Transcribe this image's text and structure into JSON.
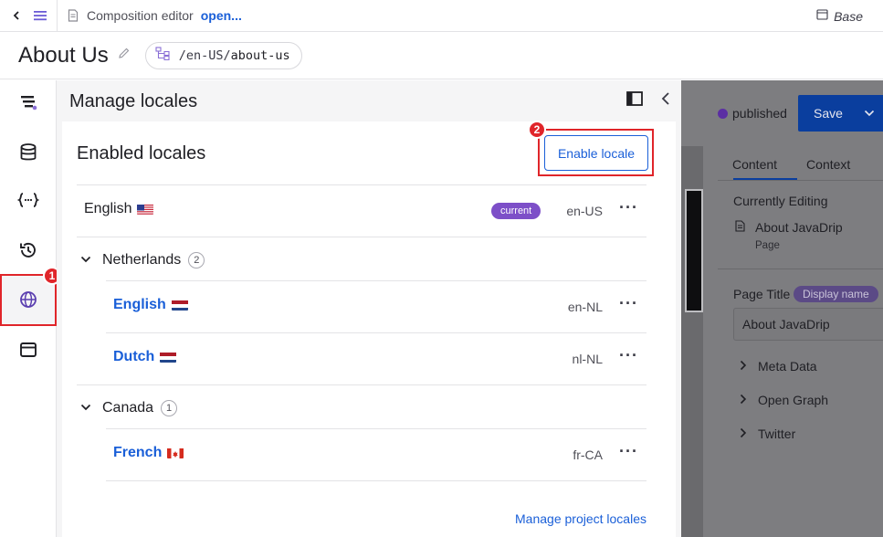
{
  "toolbar": {
    "title": "Composition editor",
    "link": "open...",
    "base_label": "Base"
  },
  "page": {
    "title": "About Us",
    "path_prefix": "/en-US/",
    "path_slug": "about-us"
  },
  "rail": {
    "badge": "1",
    "items": [
      "structure",
      "data",
      "variables",
      "history",
      "locales",
      "layout"
    ]
  },
  "panel": {
    "title": "Manage locales",
    "section_title": "Enabled locales",
    "enable_button": "Enable locale",
    "enable_badge": "2",
    "manage_link": "Manage project locales",
    "current_label": "current",
    "top_locale": {
      "name": "English",
      "flag": "US",
      "code": "en-US"
    },
    "groups": [
      {
        "name": "Netherlands",
        "count": "2",
        "locales": [
          {
            "name": "English",
            "flag": "NL",
            "code": "en-NL"
          },
          {
            "name": "Dutch",
            "flag": "NL",
            "code": "nl-NL"
          }
        ]
      },
      {
        "name": "Canada",
        "count": "1",
        "locales": [
          {
            "name": "French",
            "flag": "CA",
            "code": "fr-CA"
          }
        ]
      }
    ]
  },
  "right_panel": {
    "status": "published",
    "save": "Save",
    "tabs": [
      "Content",
      "Context"
    ],
    "currently_editing": "Currently Editing",
    "entity_name": "About JavaDrip",
    "entity_type": "Page",
    "field_label": "Page Title",
    "field_pill": "Display name",
    "field_value": "About JavaDrip",
    "sections": [
      "Meta Data",
      "Open Graph",
      "Twitter"
    ]
  },
  "colors": {
    "accent": "#1a5fd8",
    "highlight_red": "#e0252a",
    "current_purple": "#7d4fc8",
    "save_blue": "#0a3e9e"
  }
}
